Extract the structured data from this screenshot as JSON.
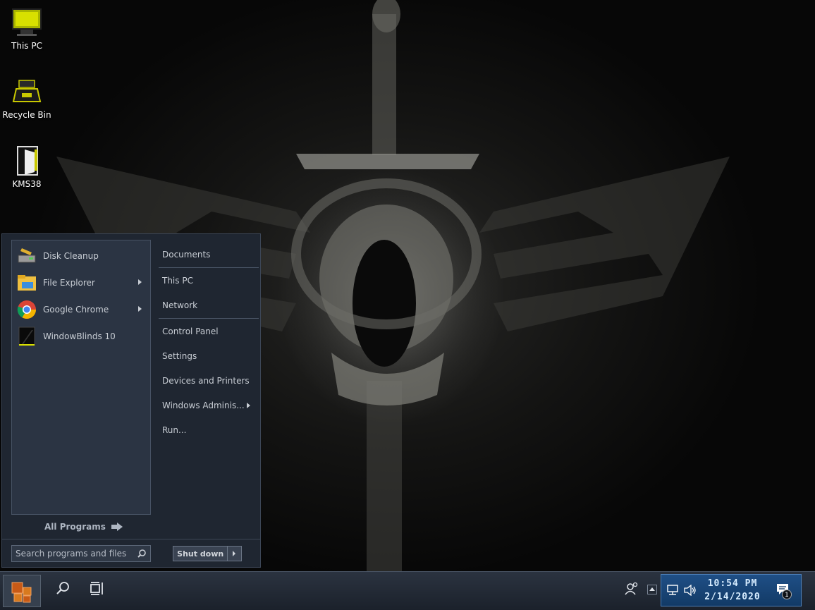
{
  "desktop": {
    "icons": [
      {
        "label": "This PC",
        "icon": "monitor-icon"
      },
      {
        "label": "Recycle Bin",
        "icon": "recycle-bin-icon"
      },
      {
        "label": "KMS38",
        "icon": "kms38-icon"
      }
    ]
  },
  "start_menu": {
    "programs": [
      {
        "label": "Disk Cleanup",
        "icon": "disk-cleanup-icon",
        "has_submenu": false
      },
      {
        "label": "File Explorer",
        "icon": "file-explorer-icon",
        "has_submenu": true
      },
      {
        "label": "Google Chrome",
        "icon": "chrome-icon",
        "has_submenu": true
      },
      {
        "label": "WindowBlinds 10",
        "icon": "windowblinds-icon",
        "has_submenu": false
      }
    ],
    "all_programs": "All Programs",
    "places": [
      {
        "label": "Documents"
      },
      {
        "label": "This PC"
      },
      {
        "label": "Network"
      },
      {
        "label": "Control Panel"
      },
      {
        "label": "Settings"
      },
      {
        "label": "Devices and Printers"
      },
      {
        "label": "Windows Adminis...",
        "has_submenu": true
      },
      {
        "label": "Run..."
      }
    ],
    "search": {
      "placeholder": "Search programs and files",
      "value": ""
    },
    "shutdown_label": "Shut down"
  },
  "taskbar": {
    "clock_time": "10:54 PM",
    "clock_date": "2/14/2020",
    "notification_count": "1"
  },
  "colors": {
    "menu_bg": "#1f2631",
    "pane_bg": "#2b3443",
    "tray_bg": "#1f4f86",
    "start_orb": "#c85a16"
  }
}
